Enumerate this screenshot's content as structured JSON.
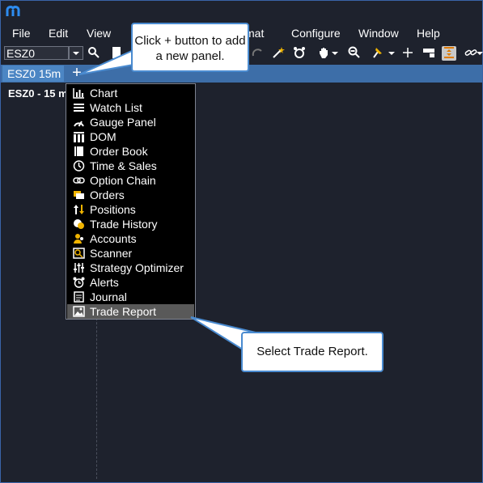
{
  "menu": [
    "File",
    "Edit",
    "View",
    "Format",
    "Configure",
    "Window",
    "Help"
  ],
  "toolbar": {
    "symbol_value": "ESZ0"
  },
  "tabs": {
    "active_label": "ESZ0 15m",
    "add_label": "+"
  },
  "chart": {
    "title": "ESZ0 - 15 m"
  },
  "panel_menu": {
    "items": [
      {
        "label": "Chart",
        "icon": "bar-chart-icon"
      },
      {
        "label": "Watch List",
        "icon": "list-icon"
      },
      {
        "label": "Gauge Panel",
        "icon": "gauge-icon"
      },
      {
        "label": "DOM",
        "icon": "dom-icon"
      },
      {
        "label": "Order Book",
        "icon": "book-icon"
      },
      {
        "label": "Time & Sales",
        "icon": "clock-dollar-icon"
      },
      {
        "label": "Option Chain",
        "icon": "chain-icon"
      },
      {
        "label": "Orders",
        "icon": "orders-icon"
      },
      {
        "label": "Positions",
        "icon": "up-down-arrows-icon"
      },
      {
        "label": "Trade History",
        "icon": "history-icon"
      },
      {
        "label": "Accounts",
        "icon": "accounts-icon"
      },
      {
        "label": "Scanner",
        "icon": "scanner-icon"
      },
      {
        "label": "Strategy Optimizer",
        "icon": "sliders-icon"
      },
      {
        "label": "Alerts",
        "icon": "alarm-clock-icon"
      },
      {
        "label": "Journal",
        "icon": "journal-icon"
      },
      {
        "label": "Trade Report",
        "icon": "image-report-icon"
      }
    ],
    "selected": "Trade Report"
  },
  "callouts": {
    "add_panel": "Click + button to add a new panel.",
    "select_report": "Select Trade Report."
  },
  "colors": {
    "accent": "#4c86c4",
    "tab_bar": "#3d6ea8",
    "background": "#1e222d",
    "callout_border": "#4a8bd0"
  }
}
